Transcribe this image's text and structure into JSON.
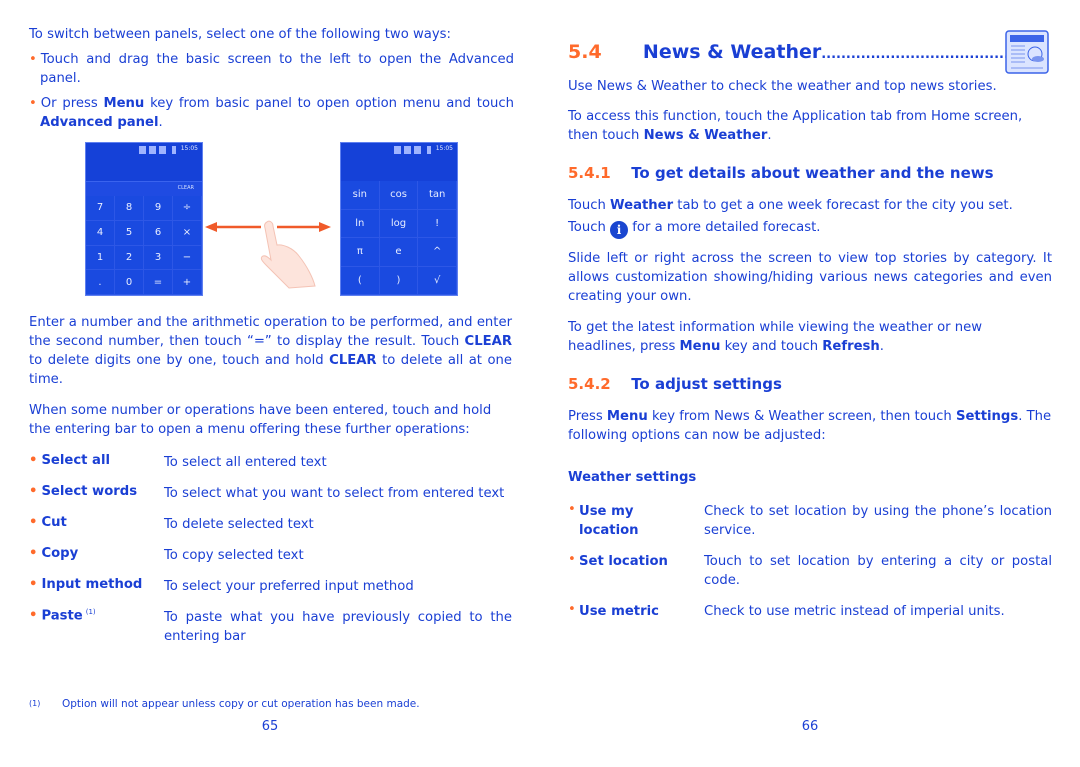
{
  "page65": {
    "intro": "To switch between panels, select one of the following two ways:",
    "bullet1": "Touch and drag the basic screen to the left to open the Advanced panel.",
    "bullet2_pre": "Or press ",
    "bullet2_bold1": "Menu",
    "bullet2_mid": " key from basic panel to open option menu and touch ",
    "bullet2_bold2": "Advanced panel",
    "bullet2_end": ".",
    "basic_panel": {
      "time": "15:05",
      "clear_label": "CLEAR",
      "keys": [
        "7",
        "8",
        "9",
        "÷",
        "4",
        "5",
        "6",
        "×",
        "1",
        "2",
        "3",
        "−",
        ".",
        "0",
        "=",
        "+"
      ]
    },
    "advanced_panel": {
      "time": "15:05",
      "keys": [
        "sin",
        "cos",
        "tan",
        "ln",
        "log",
        "!",
        "π",
        "e",
        "^",
        "(",
        ")",
        "√"
      ]
    },
    "para1_a": "Enter a number and the arithmetic operation to be performed, and enter the second number, then touch “=” to display the result. Touch ",
    "para1_b": "CLEAR",
    "para1_c": " to delete digits one by one, touch and hold ",
    "para1_d": "CLEAR",
    "para1_e": " to delete all at one time.",
    "para2": "When some number or operations have been entered, touch and hold the entering bar to open a menu offering these further operations:",
    "operations": [
      {
        "term": "Select all",
        "desc": "To select all entered text"
      },
      {
        "term": "Select words",
        "desc": "To select what you want to select from entered text"
      },
      {
        "term": "Cut",
        "desc": "To delete selected text"
      },
      {
        "term": "Copy",
        "desc": "To copy selected text"
      },
      {
        "term": "Input method",
        "desc": "To select your preferred input method"
      },
      {
        "term": "Paste",
        "sup": "(1)",
        "desc": "To paste what you have previously copied to the entering bar"
      }
    ],
    "footnote_mark": "(1)",
    "footnote": "Option will not appear unless copy or cut operation has been made.",
    "page_number": "65"
  },
  "page66": {
    "section_num": "5.4",
    "section_title": "News & Weather",
    "section_dots": "......................................",
    "intro1": "Use News & Weather to check the weather and top news stories.",
    "intro2_a": "To access this function, touch the Application tab from Home screen, then touch ",
    "intro2_b": "News & Weather",
    "intro2_c": ".",
    "sub1_num": "5.4.1",
    "sub1_title": "To get details about weather and the news",
    "p1_a": "Touch ",
    "p1_b": "Weather",
    "p1_c": " tab to get a one week forecast for the city you set.",
    "p1_d": "Touch ",
    "p1_e": " for a more detailed forecast.",
    "info_icon_glyph": "i",
    "p2": "Slide left or right across the screen to view top stories by category. It allows customization showing/hiding various news categories and even creating your own.",
    "p3_a": "To get the latest information while viewing the weather or new headlines, press ",
    "p3_b": "Menu",
    "p3_c": " key and touch ",
    "p3_d": "Refresh",
    "p3_e": ".",
    "sub2_num": "5.4.2",
    "sub2_title": "To adjust settings",
    "p4_a": "Press ",
    "p4_b": "Menu",
    "p4_c": " key from News & Weather screen, then touch ",
    "p4_d": "Settings",
    "p4_e": ". The following options can now be adjusted:",
    "weather_settings_label": "Weather settings",
    "settings": [
      {
        "term": "Use my location",
        "desc": "Check to set location by using the phone’s location service."
      },
      {
        "term": "Set location",
        "desc": "Touch to set location by entering a city or postal code."
      },
      {
        "term": "Use metric",
        "desc": "Check to use metric instead of imperial units."
      }
    ],
    "page_number": "66"
  },
  "colors": {
    "text": "#1a3fd4",
    "accent": "#ff6a2b",
    "phone_bg": "#1541d8"
  }
}
